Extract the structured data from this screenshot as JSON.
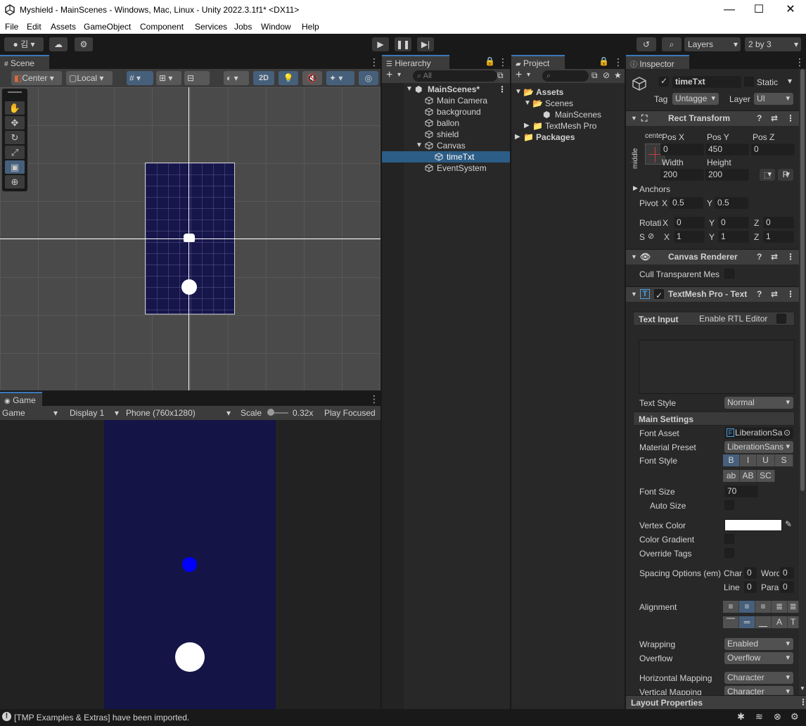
{
  "window": {
    "title": "Myshield - MainScenes - Windows, Mac, Linux - Unity 2022.3.1f1* <DX11>",
    "minimize": "—",
    "maximize": "☐",
    "close": "✕"
  },
  "menu": [
    "File",
    "Edit",
    "Assets",
    "GameObject",
    "Component",
    "Services",
    "Jobs",
    "Window",
    "Help"
  ],
  "toolbar": {
    "account": "김",
    "layers": "Layers",
    "layout": "2 by 3"
  },
  "scene": {
    "tab": "Scene",
    "pivot": "Center",
    "space": "Local",
    "mode2d": "2D"
  },
  "game": {
    "tab": "Game",
    "mode": "Game",
    "display": "Display 1",
    "resolution": "Phone (760x1280)",
    "scale_label": "Scale",
    "scale_value": "0.32x",
    "play_focused": "Play Focused"
  },
  "hierarchy": {
    "tab": "Hierarchy",
    "search_placeholder": "All",
    "scene_name": "MainScenes*",
    "items": [
      "Main Camera",
      "background",
      "ballon",
      "shield",
      "Canvas",
      "timeTxt",
      "EventSystem"
    ]
  },
  "project": {
    "tab": "Project",
    "assets": "Assets",
    "scenes": "Scenes",
    "mainscenes": "MainScenes",
    "textmeshpro": "TextMesh Pro",
    "packages": "Packages"
  },
  "inspector": {
    "tab": "Inspector",
    "object_name": "timeTxt",
    "static_label": "Static",
    "tag_label": "Tag",
    "tag_value": "Untagge",
    "layer_label": "Layer",
    "layer_value": "UI",
    "rect": {
      "header": "Rect Transform",
      "anchor_h": "center",
      "anchor_v": "middle",
      "posx_label": "Pos X",
      "posx": "0",
      "posy_label": "Pos Y",
      "posy": "450",
      "posz_label": "Pos Z",
      "posz": "0",
      "width_label": "Width",
      "width": "200",
      "height_label": "Height",
      "height": "200",
      "r_button": "R",
      "anchors": "Anchors",
      "pivot_label": "Pivot",
      "x": "X",
      "y": "Y",
      "z": "Z",
      "pivot_x": "0.5",
      "pivot_y": "0.5",
      "rot_label": "Rotati",
      "rot_x": "0",
      "rot_y": "0",
      "rot_z": "0",
      "scale_label": "S",
      "scale_x": "1",
      "scale_y": "1",
      "scale_z": "1"
    },
    "canvas_renderer": {
      "header": "Canvas Renderer",
      "cull": "Cull Transparent Mes"
    },
    "tmp": {
      "header": "TextMesh Pro - Text",
      "text_input": "Text Input",
      "rtl": "Enable RTL Editor",
      "text_style_label": "Text Style",
      "text_style": "Normal",
      "main_settings": "Main Settings",
      "font_asset_label": "Font Asset",
      "font_asset": "LiberationSa",
      "material_label": "Material Preset",
      "material": "LiberationSans",
      "font_style_label": "Font Style",
      "styles1": [
        "B",
        "I",
        "U",
        "S"
      ],
      "styles2": [
        "ab",
        "AB",
        "SC"
      ],
      "font_size_label": "Font Size",
      "font_size": "70",
      "auto_size": "Auto Size",
      "vertex_color": "Vertex Color",
      "color_gradient": "Color Gradient",
      "override_tags": "Override Tags",
      "spacing_label": "Spacing Options (em)",
      "char_label": "Char",
      "char_val": "0",
      "word_label": "Word",
      "word_val": "0",
      "line_label": "Line",
      "line_val": "0",
      "para_label": "Para",
      "para_val": "0",
      "alignment_label": "Alignment",
      "wrapping_label": "Wrapping",
      "wrapping": "Enabled",
      "overflow_label": "Overflow",
      "overflow": "Overflow",
      "hmap_label": "Horizontal Mapping",
      "hmap": "Character",
      "vmap_label": "Vertical Mapping",
      "vmap": "Character",
      "layout_props": "Layout Properties"
    }
  },
  "status": {
    "message": "[TMP Examples & Extras] have been imported."
  },
  "colors": {
    "accent": "#3a79bb",
    "selection": "#2c5d87",
    "canvas_bg": "#16164a",
    "game_bg": "#141447",
    "ball": "#0000ff"
  }
}
